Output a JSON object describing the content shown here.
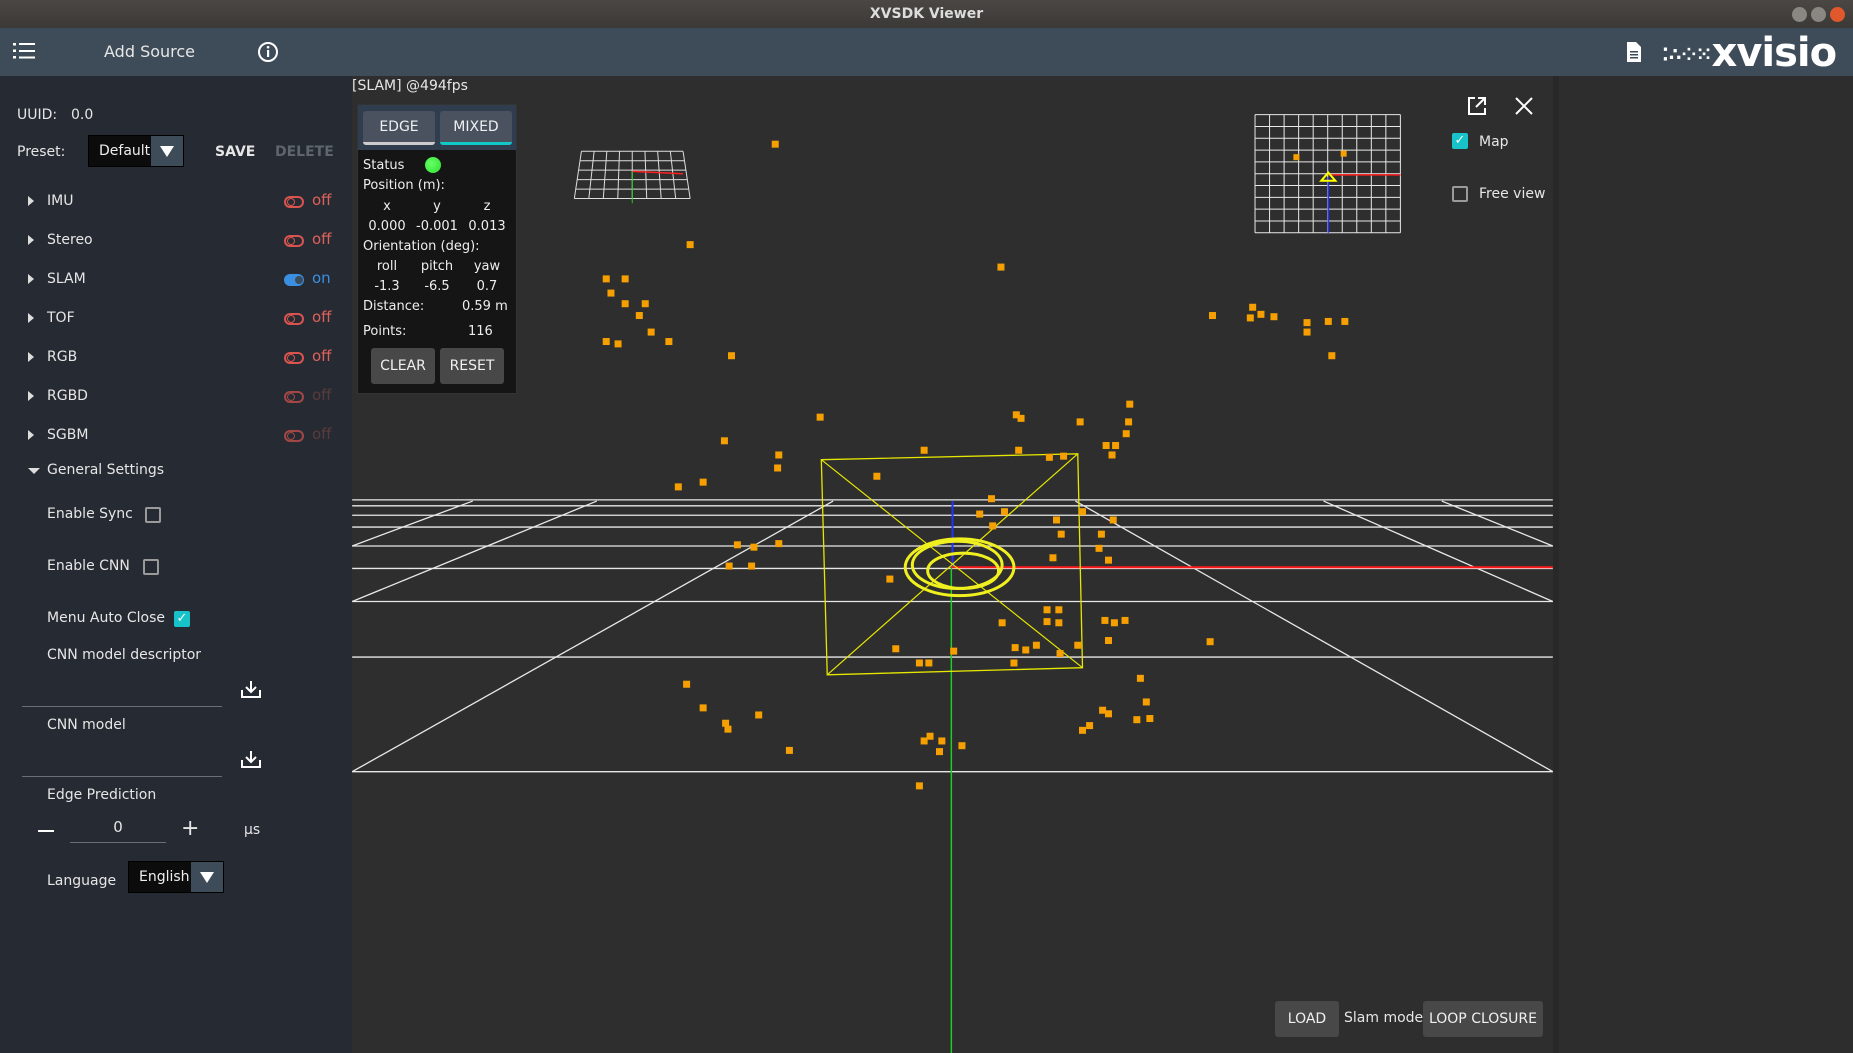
{
  "window": {
    "title": "XVSDK Viewer"
  },
  "header": {
    "add_source": "Add Source",
    "logo": "xvisio"
  },
  "sidebar": {
    "uuid_label": "UUID:",
    "uuid_value": "0.0",
    "preset_label": "Preset:",
    "preset_value": "Default",
    "save": "SAVE",
    "delete": "DELETE",
    "sources": [
      {
        "label": "IMU",
        "state": "off"
      },
      {
        "label": "Stereo",
        "state": "off"
      },
      {
        "label": "SLAM",
        "state": "on"
      },
      {
        "label": "TOF",
        "state": "off"
      },
      {
        "label": "RGB",
        "state": "off"
      },
      {
        "label": "RGBD",
        "state": "off"
      },
      {
        "label": "SGBM",
        "state": "off"
      }
    ],
    "general_settings": "General Settings",
    "enable_sync": "Enable Sync",
    "enable_cnn": "Enable CNN",
    "menu_auto_close": "Menu Auto Close",
    "cnn_model_descriptor": "CNN model descriptor",
    "cnn_model": "CNN model",
    "edge_prediction": "Edge Prediction",
    "edge_prediction_value": "0",
    "edge_unit": "µs",
    "language_label": "Language",
    "language_value": "English"
  },
  "viewer": {
    "title": "[SLAM]  @494fps",
    "tabs": [
      "EDGE",
      "MIXED"
    ],
    "status_label": "Status",
    "status_color": "#2ee02e",
    "position_label": "Position (m):",
    "pos_axes": [
      "x",
      "y",
      "z"
    ],
    "pos_values": [
      "0.000",
      "-0.001",
      "0.013"
    ],
    "orientation_label": "Orientation (deg):",
    "ori_axes": [
      "roll",
      "pitch",
      "yaw"
    ],
    "ori_values": [
      "-1.3",
      "-6.5",
      "0.7"
    ],
    "distance_label": "Distance:",
    "distance_value": "0.59  m",
    "points_label": "Points:",
    "points_value": "116",
    "clear": "CLEAR",
    "reset": "RESET",
    "map_label": "Map",
    "free_view_label": "Free view",
    "load": "LOAD",
    "slam_mode_label": "Slam mode",
    "loop_closure": "LOOP CLOSURE"
  }
}
